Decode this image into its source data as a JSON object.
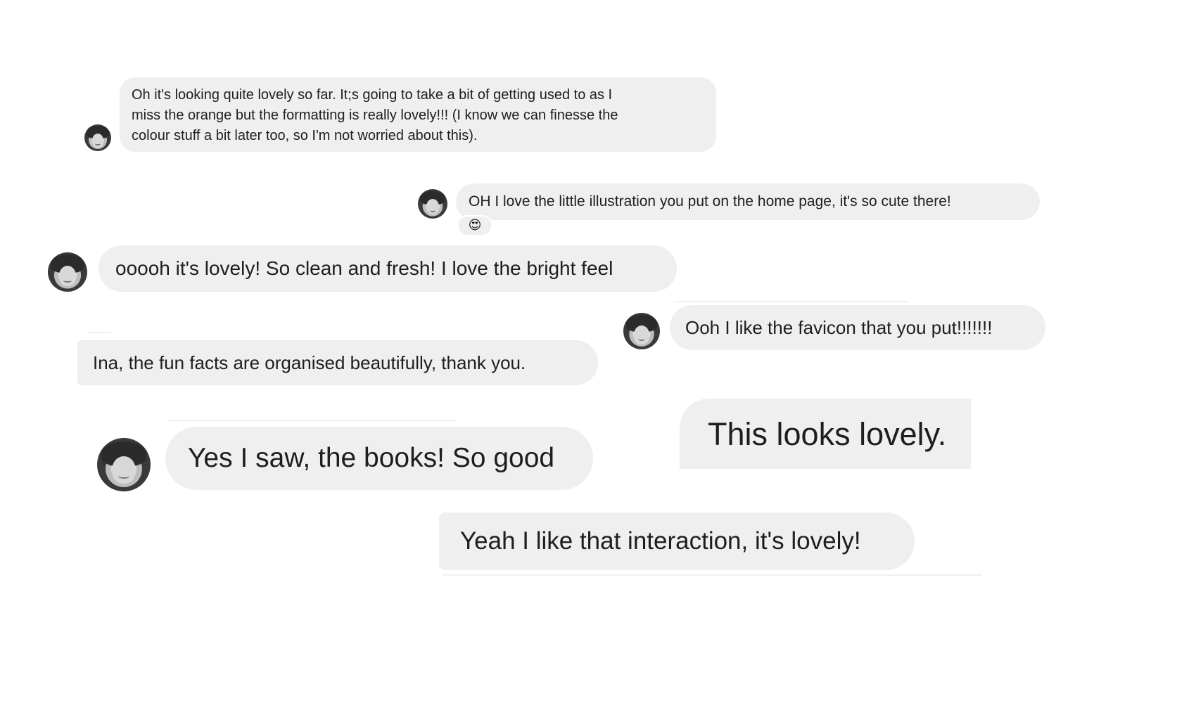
{
  "messages": [
    {
      "text_lines": [
        "Oh it's looking quite lovely so far. It;s going to take a bit of getting used to as I",
        "miss the orange but the formatting is really lovely!!! (I know we can finesse the",
        "colour stuff a bit later too, so I'm not worried about this)."
      ]
    },
    {
      "text": "OH I love the little illustration you put on the home page, it's so cute there!",
      "reaction": "😍"
    },
    {
      "text": "ooooh it's lovely! So clean and fresh! I love the bright feel"
    },
    {
      "text": "Ooh I like the favicon that you put!!!!!!!"
    },
    {
      "text": "Ina, the fun facts are organised beautifully, thank you."
    },
    {
      "text": "Yes I saw, the books! So good"
    },
    {
      "text": "This looks lovely."
    },
    {
      "text": "Yeah I like that interaction, it's lovely!"
    }
  ],
  "colors": {
    "bubble": "#efefef",
    "text": "#1c1e21",
    "background": "#ffffff"
  },
  "icons": [
    "avatar-photo",
    "heart-eyes-emoji"
  ]
}
